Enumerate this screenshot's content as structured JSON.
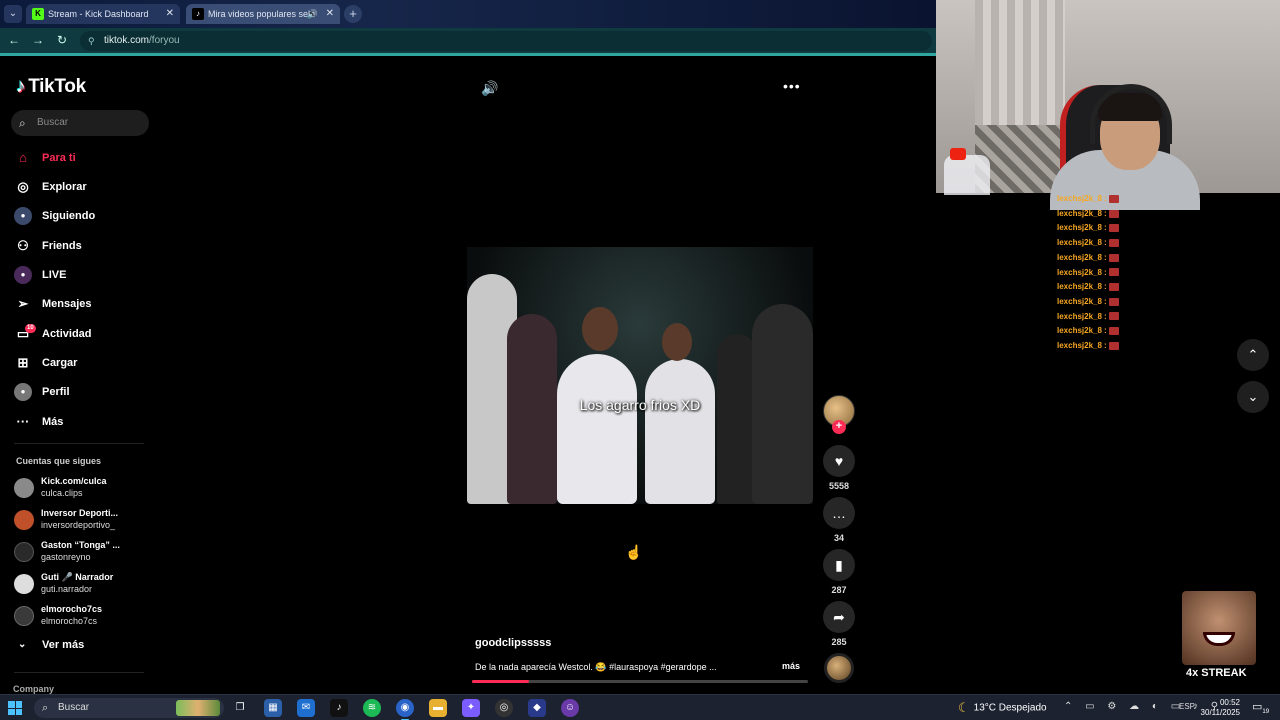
{
  "browser": {
    "tabs": [
      {
        "favicon": "K",
        "title": "Stream - Kick Dashboard"
      },
      {
        "favicon": "♪",
        "title": "Mira videos populares sele"
      }
    ],
    "url_domain": "tiktok.com",
    "url_path": "/foryou"
  },
  "sidebar": {
    "logo_text": "TikTok",
    "search_placeholder": "Buscar",
    "nav": [
      {
        "label": "Para ti",
        "icon": "home-icon"
      },
      {
        "label": "Explorar",
        "icon": "compass-icon"
      },
      {
        "label": "Siguiendo",
        "icon": "following-avatar-icon"
      },
      {
        "label": "Friends",
        "icon": "friends-icon"
      },
      {
        "label": "LIVE",
        "icon": "live-icon"
      },
      {
        "label": "Mensajes",
        "icon": "send-icon"
      },
      {
        "label": "Actividad",
        "icon": "activity-icon",
        "badge": "10"
      },
      {
        "label": "Cargar",
        "icon": "upload-icon"
      },
      {
        "label": "Perfil",
        "icon": "profile-avatar-icon"
      },
      {
        "label": "Más",
        "icon": "more-dots-icon"
      }
    ],
    "following_title": "Cuentas que sigues",
    "following": [
      {
        "name": "Kick.com/culca",
        "user": "culca.clips",
        "color": "#8a8a8a"
      },
      {
        "name": "Inversor Deporti...",
        "user": "inversordeportivo_",
        "color": "#c0502a"
      },
      {
        "name": "Gaston “Tonga” ...",
        "user": "gastonreyno",
        "color": "#2a2a2a"
      },
      {
        "name": "Guti 🎤 Narrador",
        "user": "guti.narrador",
        "color": "#dddddd"
      },
      {
        "name": "elmorocho7cs",
        "user": "elmorocho7cs",
        "color": "#3a3a3a"
      }
    ],
    "see_more": "Ver más",
    "company": "Company"
  },
  "video": {
    "caption": "Los agarro frios XD",
    "author": "goodclipsssss",
    "description": "De la nada aparecía Westcol. 😂 #lauraspoya #gerardope ...",
    "more_label": "más",
    "progress": 0.17,
    "likes": "5558",
    "comments": "34",
    "saves": "287",
    "shares": "285"
  },
  "chat": {
    "user": "lexchsj2k_8",
    "separator": ":",
    "line_count": 11
  },
  "streak_label": "4x STREAK",
  "taskbar": {
    "search_label": "Buscar",
    "weather": "13°C  Despejado",
    "language": "ESP",
    "time": "00:52",
    "date": "30/11/2025",
    "notification_count": "19"
  },
  "colors": {
    "accent": "#fe2c55",
    "chat_user": "#f5a623"
  }
}
